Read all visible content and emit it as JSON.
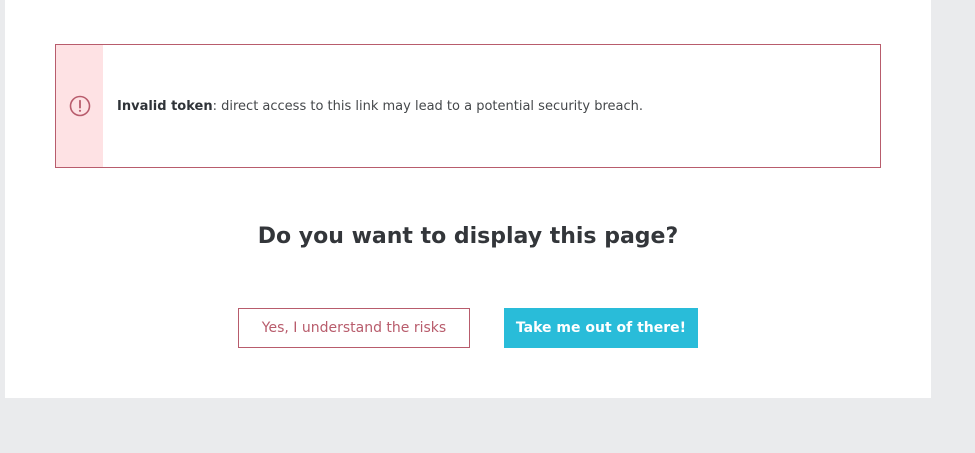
{
  "alert": {
    "icon": "exclamation-circle-icon",
    "title": "Invalid token",
    "message": ": direct access to this link may lead to a potential security breach."
  },
  "prompt": {
    "question": "Do you want to display this page?"
  },
  "buttons": {
    "accept_risk_label": "Yes, I understand the risks",
    "leave_label": "Take me out of there!"
  },
  "colors": {
    "page_background": "#eaebed",
    "panel_background": "#ffffff",
    "danger": "#b85c6c",
    "danger_light": "#fee2e4",
    "accent": "#29bcd9",
    "text": "#33363a"
  }
}
